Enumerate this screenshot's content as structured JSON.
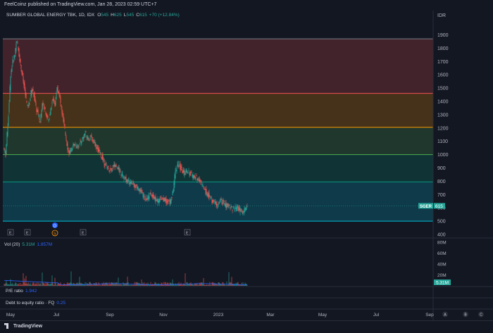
{
  "header": {
    "published": "FeelCoinz published on TradingView.com, Jan 28, 2023 02:59 UTC+7",
    "currency": "IDR"
  },
  "legend": {
    "symbol": "SUMBER GLOBAL ENERGY TBK, 1D, IDX",
    "o_label": "O",
    "o_value": "545",
    "h_label": "H",
    "h_value": "625",
    "l_label": "L",
    "l_value": "545",
    "c_label": "C",
    "c_value": "615",
    "change": "+70 (+12.84%)"
  },
  "price_tag": {
    "symbol": "SGER",
    "value": "615"
  },
  "volume": {
    "label": "Vol (20)",
    "value": "5.31M",
    "ma": "1.857M",
    "tag": "5.31M"
  },
  "indicators": [
    {
      "label": "P/E ratio",
      "value": "1.942"
    },
    {
      "label": "Debt to equity ratio · FQ",
      "value": "0.25"
    }
  ],
  "event_markers": [
    "E",
    "E",
    "E",
    "E"
  ],
  "dividend_marker": "D",
  "split_marker": "S",
  "footer": {
    "brand": "TradingView",
    "buttons": [
      "A",
      "B",
      "C"
    ]
  },
  "colors": {
    "up": "#26a69a",
    "down": "#ef5350",
    "background": "#131722"
  },
  "chart_data": {
    "type": "candlestick",
    "title": "SUMBER GLOBAL ENERGY TBK, 1D, IDX",
    "y_ticks": [
      500,
      600,
      700,
      800,
      900,
      1000,
      1100,
      1200,
      1300,
      1400,
      1500,
      1600,
      1700,
      1800,
      1900
    ],
    "y_extra_tick": 400,
    "ylim": [
      400,
      1950
    ],
    "x_ticks": [
      "May",
      "Jul",
      "Sep",
      "Nov",
      "2023",
      "Mar",
      "May",
      "Jul",
      "Sep"
    ],
    "fib_levels": [
      {
        "price": 1870,
        "color": "#787b86"
      },
      {
        "price": 1460,
        "color": "#ef5350"
      },
      {
        "price": 1205,
        "color": "#ff9800"
      },
      {
        "price": 1000,
        "color": "#4caf50"
      },
      {
        "price": 795,
        "color": "#089981"
      },
      {
        "price": 500,
        "color": "#00bcd4"
      }
    ],
    "fib_zones": [
      {
        "from": 1460,
        "to": 1870,
        "color": "#ef5350"
      },
      {
        "from": 1205,
        "to": 1460,
        "color": "#ff9800"
      },
      {
        "from": 1000,
        "to": 1205,
        "color": "#4caf50"
      },
      {
        "from": 795,
        "to": 1000,
        "color": "#089981"
      },
      {
        "from": 500,
        "to": 795,
        "color": "#00bcd4"
      }
    ],
    "close_path": [
      [
        0,
        1050
      ],
      [
        3,
        1000
      ],
      [
        7,
        1300
      ],
      [
        10,
        1600
      ],
      [
        13,
        1700
      ],
      [
        16,
        1750
      ],
      [
        18,
        1850
      ],
      [
        20,
        1820
      ],
      [
        22,
        1750
      ],
      [
        25,
        1650
      ],
      [
        28,
        1550
      ],
      [
        31,
        1450
      ],
      [
        34,
        1350
      ],
      [
        37,
        1400
      ],
      [
        40,
        1500
      ],
      [
        43,
        1450
      ],
      [
        46,
        1350
      ],
      [
        49,
        1300
      ],
      [
        52,
        1250
      ],
      [
        55,
        1400
      ],
      [
        58,
        1350
      ],
      [
        61,
        1300
      ],
      [
        64,
        1250
      ],
      [
        67,
        1350
      ],
      [
        70,
        1420
      ],
      [
        73,
        1380
      ],
      [
        76,
        1500
      ],
      [
        79,
        1450
      ],
      [
        82,
        1350
      ],
      [
        85,
        1250
      ],
      [
        88,
        1150
      ],
      [
        91,
        1050
      ],
      [
        94,
        1000
      ],
      [
        97,
        1050
      ],
      [
        100,
        1080
      ],
      [
        104,
        1060
      ],
      [
        108,
        1080
      ],
      [
        112,
        1120
      ],
      [
        116,
        1160
      ],
      [
        120,
        1120
      ],
      [
        124,
        1130
      ],
      [
        128,
        1100
      ],
      [
        132,
        1060
      ],
      [
        136,
        1010
      ],
      [
        140,
        980
      ],
      [
        144,
        930
      ],
      [
        148,
        900
      ],
      [
        152,
        880
      ],
      [
        156,
        910
      ],
      [
        160,
        930
      ],
      [
        164,
        880
      ],
      [
        168,
        850
      ],
      [
        172,
        820
      ],
      [
        176,
        800
      ],
      [
        180,
        790
      ],
      [
        184,
        780
      ],
      [
        188,
        760
      ],
      [
        192,
        740
      ],
      [
        196,
        720
      ],
      [
        200,
        680
      ],
      [
        204,
        670
      ],
      [
        208,
        700
      ],
      [
        212,
        690
      ],
      [
        216,
        660
      ],
      [
        220,
        650
      ],
      [
        224,
        680
      ],
      [
        228,
        660
      ],
      [
        232,
        650
      ],
      [
        236,
        640
      ],
      [
        240,
        700
      ],
      [
        244,
        880
      ],
      [
        248,
        930
      ],
      [
        252,
        890
      ],
      [
        256,
        860
      ],
      [
        260,
        880
      ],
      [
        264,
        860
      ],
      [
        268,
        840
      ],
      [
        272,
        830
      ],
      [
        276,
        820
      ],
      [
        280,
        790
      ],
      [
        284,
        750
      ],
      [
        288,
        710
      ],
      [
        292,
        690
      ],
      [
        296,
        650
      ],
      [
        300,
        640
      ],
      [
        304,
        620
      ],
      [
        308,
        650
      ],
      [
        312,
        640
      ],
      [
        316,
        610
      ],
      [
        320,
        620
      ],
      [
        324,
        600
      ],
      [
        328,
        590
      ],
      [
        332,
        600
      ],
      [
        336,
        580
      ],
      [
        340,
        560
      ],
      [
        343,
        590
      ],
      [
        346,
        615
      ]
    ],
    "volume_ylim": [
      0,
      80
    ],
    "volume_ticks": [
      20,
      40,
      60,
      80
    ],
    "volume_unit": "M"
  }
}
